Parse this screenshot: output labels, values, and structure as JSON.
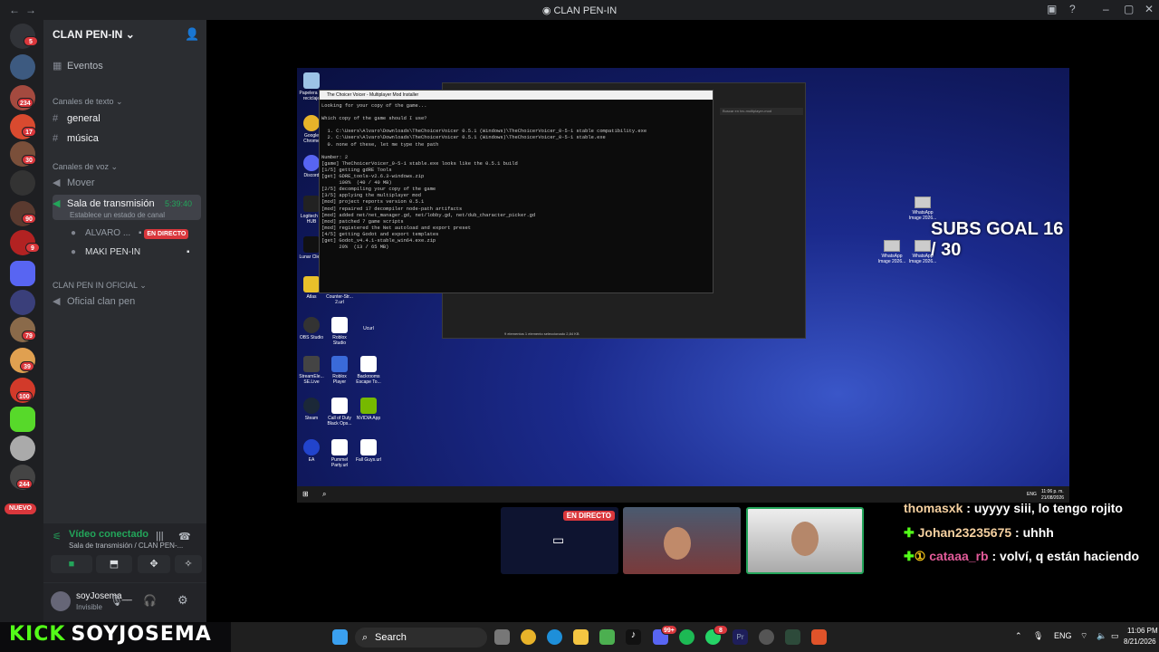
{
  "window": {
    "title": "CLAN PEN-IN"
  },
  "server_rail": {
    "badges": [
      "5",
      "234",
      "17",
      "30",
      "90",
      "9",
      "79",
      "39",
      "100",
      "244"
    ],
    "new_label": "NUEVO"
  },
  "sidebar": {
    "server_name": "CLAN PEN-IN",
    "events_label": "Eventos",
    "text_category": "Canales de texto",
    "text_channels": [
      "general",
      "música"
    ],
    "voice_category": "Canales de voz",
    "voice_channels": {
      "mover": "Mover",
      "stream_channel": "Sala de transmisión",
      "stream_time": "5:39:40",
      "stream_status": "Establece un estado de canal",
      "members": [
        {
          "name": "ALVARO ...",
          "live": "EN DIRECTO"
        },
        {
          "name": "MAKI PEN-IN"
        }
      ]
    },
    "official_category": "CLAN PEN IN OFICIAL",
    "official_channel": "Oficial clan pen",
    "voice_panel": {
      "status": "Vídeo conectado",
      "location": "Sala de transmisión / CLAN PEN-..."
    },
    "user_panel": {
      "username": "soyJosema__",
      "status": "Invisible"
    }
  },
  "stream": {
    "desktop_icons": [
      "Papelera de reciclaje",
      "Google Chrome",
      "Discord",
      "Logitech G HUB",
      "Lunar Client",
      "Atlas",
      "Counter-Str... 2.url",
      "OBS Studio",
      "Roblox Studio",
      "Ucurl",
      "StreamEle... SE.Live",
      "Roblox Player",
      "Backrooms Escape To...",
      "Steam",
      "Call of Duty Black Ops...",
      "NVIDIA App",
      "EA",
      "Pummel Party.url",
      "Fall Guys.url"
    ],
    "explorer": {
      "search_placeholder": "Buscar en txv-multiplayer-mod",
      "status": "9 elementos   1 elemento seleccionado  2,84 KB"
    },
    "terminal": {
      "title": "The Choicer Voicer - Multiplayer Mod Installer",
      "lines": [
        "Looking for your copy of the game...",
        "",
        "Which copy of the game should I use?",
        "",
        "  1. C:\\Users\\Alvaro\\Downloads\\TheChoicerVoicer 0.5.1 (Windows)\\TheChoicerVoicer_0-5-1 stable compatibility.exe",
        "  2. C:\\Users\\Alvaro\\Downloads\\TheChoicerVoicer 0.5.1 (Windows)\\TheChoicerVoicer_0-5-1 stable.exe",
        "  0. none of these, let me type the path",
        "",
        "Number: 2",
        "[game] TheChoicerVoicer_0-5-1 stable.exe looks like the 0.5.1 build",
        "[1/5] getting gdRE Tools",
        "[get] GDRE_tools-v2.6.3-windows.zip",
        "      100%  (40 / 40 MB)",
        "[2/5] decompiling your copy of the game",
        "[3/5] applying the multiplayer mod",
        "[mod] project reports version 0.5.1",
        "[mod] repaired 17 decompiler node-path artifacts",
        "[mod] added net/net_manager.gd, net/lobby.gd, net/dub_character_picker.gd",
        "[mod] patched 7 game scripts",
        "[mod] registered the Net autoload and export preset",
        "[4/5] getting Godot and export templates",
        "[get] Godot_v4.4.1-stable_win64.exe.zip",
        "      20%  (13 / 65 MB)"
      ]
    },
    "whatsapp_files": [
      "WhatsApp Image 2026...",
      "WhatsApp Image 2026...",
      "WhatsApp Image 2026..."
    ],
    "subs_goal": "SUBS GOAL 16 / 30",
    "desk_taskbar": {
      "lang": "ENG",
      "time": "11:06 p. m.",
      "date": "21/08/2026"
    }
  },
  "cams": {
    "live_label": "EN DIRECTO"
  },
  "chat": [
    {
      "user": "thomasxk",
      "message": "uyyyy siii, lo tengo rojito",
      "color": "#f2c9a1"
    },
    {
      "user": "Johan23235675",
      "message": "uhhh",
      "color": "#f2c9a1"
    },
    {
      "user": "cataaa_rb",
      "message": "volví, q están haciendo",
      "color": "#e35b9a"
    }
  ],
  "overlay": {
    "brand": "KICK",
    "channel": "SOYJOSEMA"
  },
  "taskbar": {
    "search_placeholder": "Search",
    "lang": "ENG",
    "time": "11:06 PM",
    "date": "8/21/2026",
    "badges": [
      "99+",
      "8"
    ]
  },
  "colors": {
    "accent_green": "#53fc18",
    "live_red": "#da373c",
    "discord_bg": "#2b2d31"
  }
}
